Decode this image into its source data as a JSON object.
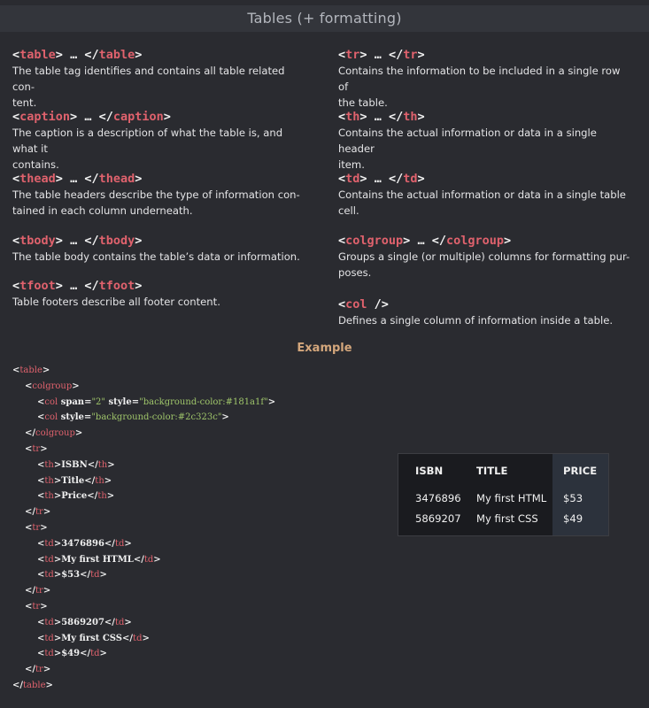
{
  "title": "Tables (+ formatting)",
  "tags_left": [
    {
      "open": "table",
      "close": "table",
      "desc": "The table tag identifies and contains all table related con-\ntent."
    },
    {
      "open": "caption",
      "close": "caption",
      "desc": "The caption is a description of what the table is, and what it\ncontains."
    },
    {
      "open": "thead",
      "close": "thead",
      "desc": "The table headers describe the type of information con-\ntained in each column underneath."
    },
    {
      "open": "tbody",
      "close": "tbody",
      "desc": "The table body contains the table’s data or information."
    },
    {
      "open": "tfoot",
      "close": "tfoot",
      "desc": "Table footers describe all footer content."
    }
  ],
  "tags_right": [
    {
      "open": "tr",
      "close": "tr",
      "desc": "Contains the information to be included in a single row of\nthe table."
    },
    {
      "open": "th",
      "close": "th",
      "desc": "Contains the actual information or data in a single header\nitem."
    },
    {
      "open": "td",
      "close": "td",
      "desc": "Contains the actual information or data in a single table\ncell."
    },
    {
      "open": "colgroup",
      "close": "colgroup",
      "desc": "Groups a single (or multiple) columns for formatting pur-\nposes."
    },
    {
      "open": "col",
      "close": "",
      "desc": "Defines a single column of information inside a table."
    }
  ],
  "ellipsis": "…",
  "example_title": "Example",
  "code_lines": [
    {
      "indent": 0,
      "parts": [
        [
          "p",
          "<"
        ],
        [
          "t",
          "table"
        ],
        [
          "p",
          ">"
        ]
      ]
    },
    {
      "indent": 1,
      "parts": [
        [
          "p",
          "<"
        ],
        [
          "t",
          "colgroup"
        ],
        [
          "p",
          ">"
        ]
      ]
    },
    {
      "indent": 2,
      "parts": [
        [
          "p",
          "<"
        ],
        [
          "t",
          "col"
        ],
        [
          "p",
          " span="
        ],
        [
          "s",
          "\"2\""
        ],
        [
          "p",
          " style="
        ],
        [
          "s",
          "\"background-color:#181a1f\""
        ],
        [
          "p",
          ">"
        ]
      ]
    },
    {
      "indent": 2,
      "parts": [
        [
          "p",
          "<"
        ],
        [
          "t",
          "col"
        ],
        [
          "p",
          " style="
        ],
        [
          "s",
          "\"background-color:#2c323c\""
        ],
        [
          "p",
          ">"
        ]
      ]
    },
    {
      "indent": 1,
      "parts": [
        [
          "p",
          "</"
        ],
        [
          "t",
          "colgroup"
        ],
        [
          "p",
          ">"
        ]
      ]
    },
    {
      "indent": 1,
      "parts": [
        [
          "p",
          "<"
        ],
        [
          "t",
          "tr"
        ],
        [
          "p",
          ">"
        ]
      ]
    },
    {
      "indent": 2,
      "parts": [
        [
          "p",
          "<"
        ],
        [
          "t",
          "th"
        ],
        [
          "p",
          ">ISBN</"
        ],
        [
          "t",
          "th"
        ],
        [
          "p",
          ">"
        ]
      ]
    },
    {
      "indent": 2,
      "parts": [
        [
          "p",
          "<"
        ],
        [
          "t",
          "th"
        ],
        [
          "p",
          ">Title</"
        ],
        [
          "t",
          "th"
        ],
        [
          "p",
          ">"
        ]
      ]
    },
    {
      "indent": 2,
      "parts": [
        [
          "p",
          "<"
        ],
        [
          "t",
          "th"
        ],
        [
          "p",
          ">Price</"
        ],
        [
          "t",
          "th"
        ],
        [
          "p",
          ">"
        ]
      ]
    },
    {
      "indent": 1,
      "parts": [
        [
          "p",
          "</"
        ],
        [
          "t",
          "tr"
        ],
        [
          "p",
          ">"
        ]
      ]
    },
    {
      "indent": 1,
      "parts": [
        [
          "p",
          "<"
        ],
        [
          "t",
          "tr"
        ],
        [
          "p",
          ">"
        ]
      ]
    },
    {
      "indent": 2,
      "parts": [
        [
          "p",
          "<"
        ],
        [
          "t",
          "td"
        ],
        [
          "p",
          ">3476896</"
        ],
        [
          "t",
          "td"
        ],
        [
          "p",
          ">"
        ]
      ]
    },
    {
      "indent": 2,
      "parts": [
        [
          "p",
          "<"
        ],
        [
          "t",
          "td"
        ],
        [
          "p",
          ">My first HTML</"
        ],
        [
          "t",
          "td"
        ],
        [
          "p",
          ">"
        ]
      ]
    },
    {
      "indent": 2,
      "parts": [
        [
          "p",
          "<"
        ],
        [
          "t",
          "td"
        ],
        [
          "p",
          ">$53</"
        ],
        [
          "t",
          "td"
        ],
        [
          "p",
          ">"
        ]
      ]
    },
    {
      "indent": 1,
      "parts": [
        [
          "p",
          "</"
        ],
        [
          "t",
          "tr"
        ],
        [
          "p",
          ">"
        ]
      ]
    },
    {
      "indent": 1,
      "parts": [
        [
          "p",
          "<"
        ],
        [
          "t",
          "tr"
        ],
        [
          "p",
          ">"
        ]
      ]
    },
    {
      "indent": 2,
      "parts": [
        [
          "p",
          "<"
        ],
        [
          "t",
          "td"
        ],
        [
          "p",
          ">5869207</"
        ],
        [
          "t",
          "td"
        ],
        [
          "p",
          ">"
        ]
      ]
    },
    {
      "indent": 2,
      "parts": [
        [
          "p",
          "<"
        ],
        [
          "t",
          "td"
        ],
        [
          "p",
          ">My first CSS</"
        ],
        [
          "t",
          "td"
        ],
        [
          "p",
          ">"
        ]
      ]
    },
    {
      "indent": 2,
      "parts": [
        [
          "p",
          "<"
        ],
        [
          "t",
          "td"
        ],
        [
          "p",
          ">$49</"
        ],
        [
          "t",
          "td"
        ],
        [
          "p",
          ">"
        ]
      ]
    },
    {
      "indent": 1,
      "parts": [
        [
          "p",
          "</"
        ],
        [
          "t",
          "tr"
        ],
        [
          "p",
          ">"
        ]
      ]
    },
    {
      "indent": 0,
      "parts": [
        [
          "p",
          "</"
        ],
        [
          "t",
          "table"
        ],
        [
          "p",
          ">"
        ]
      ]
    }
  ],
  "demo_table": {
    "headers": [
      "ISBN",
      "TITLE",
      "PRICE"
    ],
    "rows": [
      [
        "3476896",
        "My first HTML",
        "$53"
      ],
      [
        "5869207",
        "My first CSS",
        "$49"
      ]
    ]
  },
  "colors": {
    "background": "#2a2b30",
    "tag": "#e0626d",
    "string": "#9fc56a",
    "example": "#d4a77c"
  }
}
